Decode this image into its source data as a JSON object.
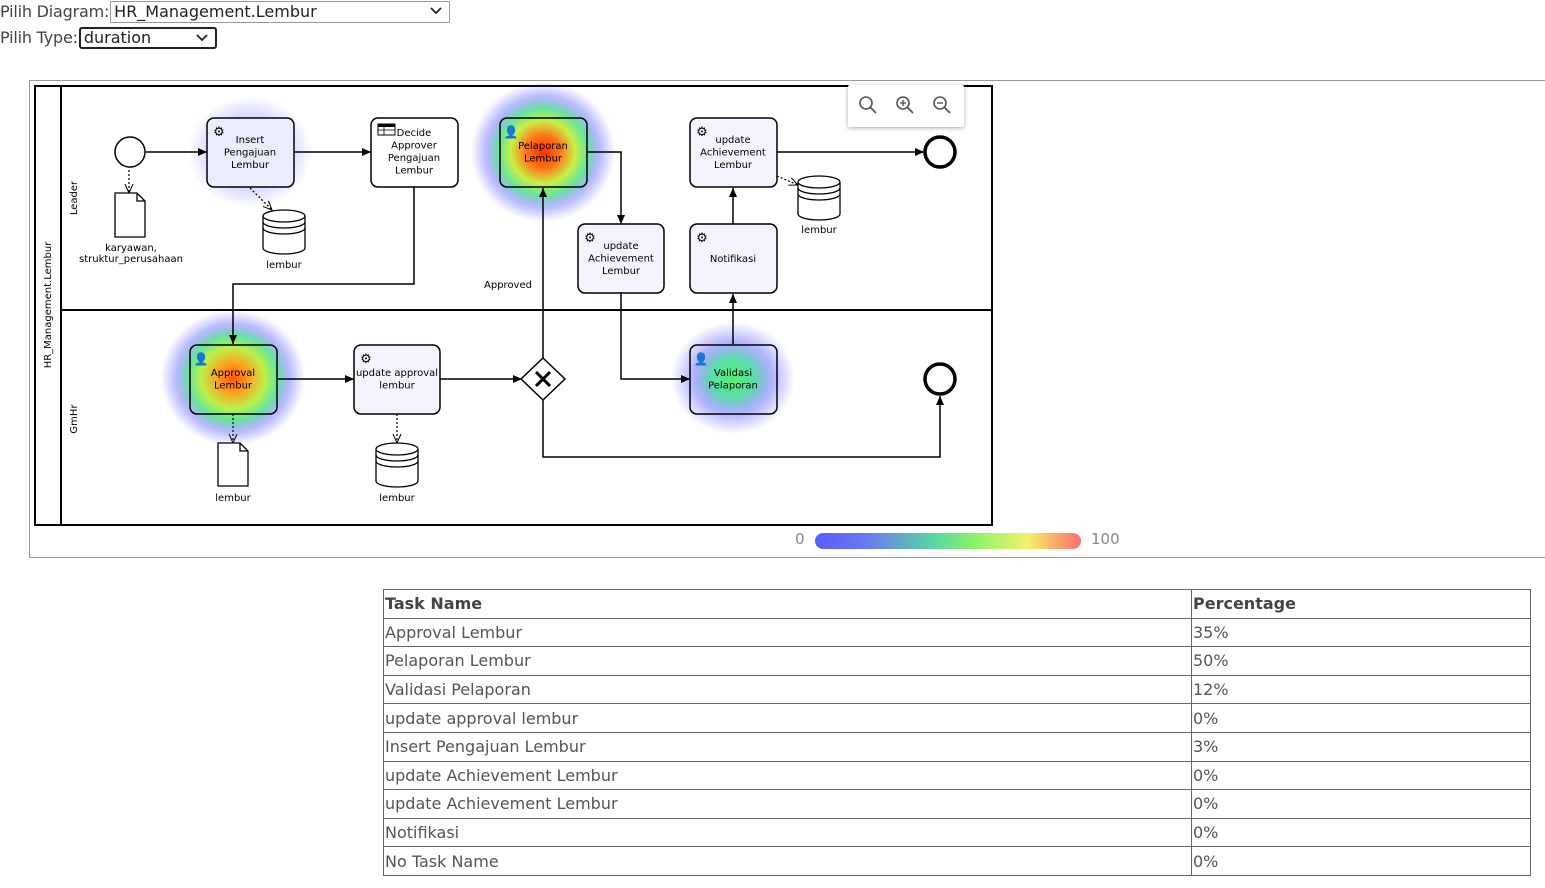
{
  "controls": {
    "diagram_label": "Pilih Diagram:",
    "diagram_value": "HR_Management.Lembur",
    "type_label": "Pilih Type:",
    "type_value": "duration"
  },
  "diagram": {
    "pool": "HR_Management.Lembur",
    "lanes": [
      "Leader",
      "GmHr"
    ],
    "tasks": {
      "insert": "Insert Pengajuan Lembur",
      "decide": "Decide Approver Pengajuan Lembur",
      "pelaporan": "Pelaporan Lembur",
      "update_ach_top": "update Achievement Lembur",
      "update_ach_mid": "update Achievement Lembur",
      "notifikasi": "Notifikasi",
      "approval": "Approval Lembur",
      "update_approval": "update approval lembur",
      "validasi": "Validasi Pelaporan"
    },
    "data_objects": {
      "karyawan": "karyawan, struktur_perusahaan",
      "lembur_doc": "lembur"
    },
    "data_stores": {
      "ds1": "lembur",
      "ds2": "lembur",
      "ds3": "lembur"
    },
    "flow_label": "Approved"
  },
  "zoom": {
    "icons": [
      "zoom-reset-icon",
      "zoom-in-icon",
      "zoom-out-icon"
    ]
  },
  "legend": {
    "min": "0",
    "max": "100",
    "colors": [
      "#5b5bff",
      "#5ad7a0",
      "#8bf26a",
      "#f2f26a",
      "#ff6b6b"
    ]
  },
  "table": {
    "headers": [
      "Task Name",
      "Percentage"
    ],
    "rows": [
      [
        "Approval Lembur",
        "35%"
      ],
      [
        "Pelaporan Lembur",
        "50%"
      ],
      [
        "Validasi Pelaporan",
        "12%"
      ],
      [
        "update approval lembur",
        "0%"
      ],
      [
        "Insert Pengajuan Lembur",
        "3%"
      ],
      [
        "update Achievement Lembur",
        "0%"
      ],
      [
        "update Achievement Lembur",
        "0%"
      ],
      [
        "Notifikasi",
        "0%"
      ],
      [
        "No Task Name",
        "0%"
      ]
    ]
  }
}
